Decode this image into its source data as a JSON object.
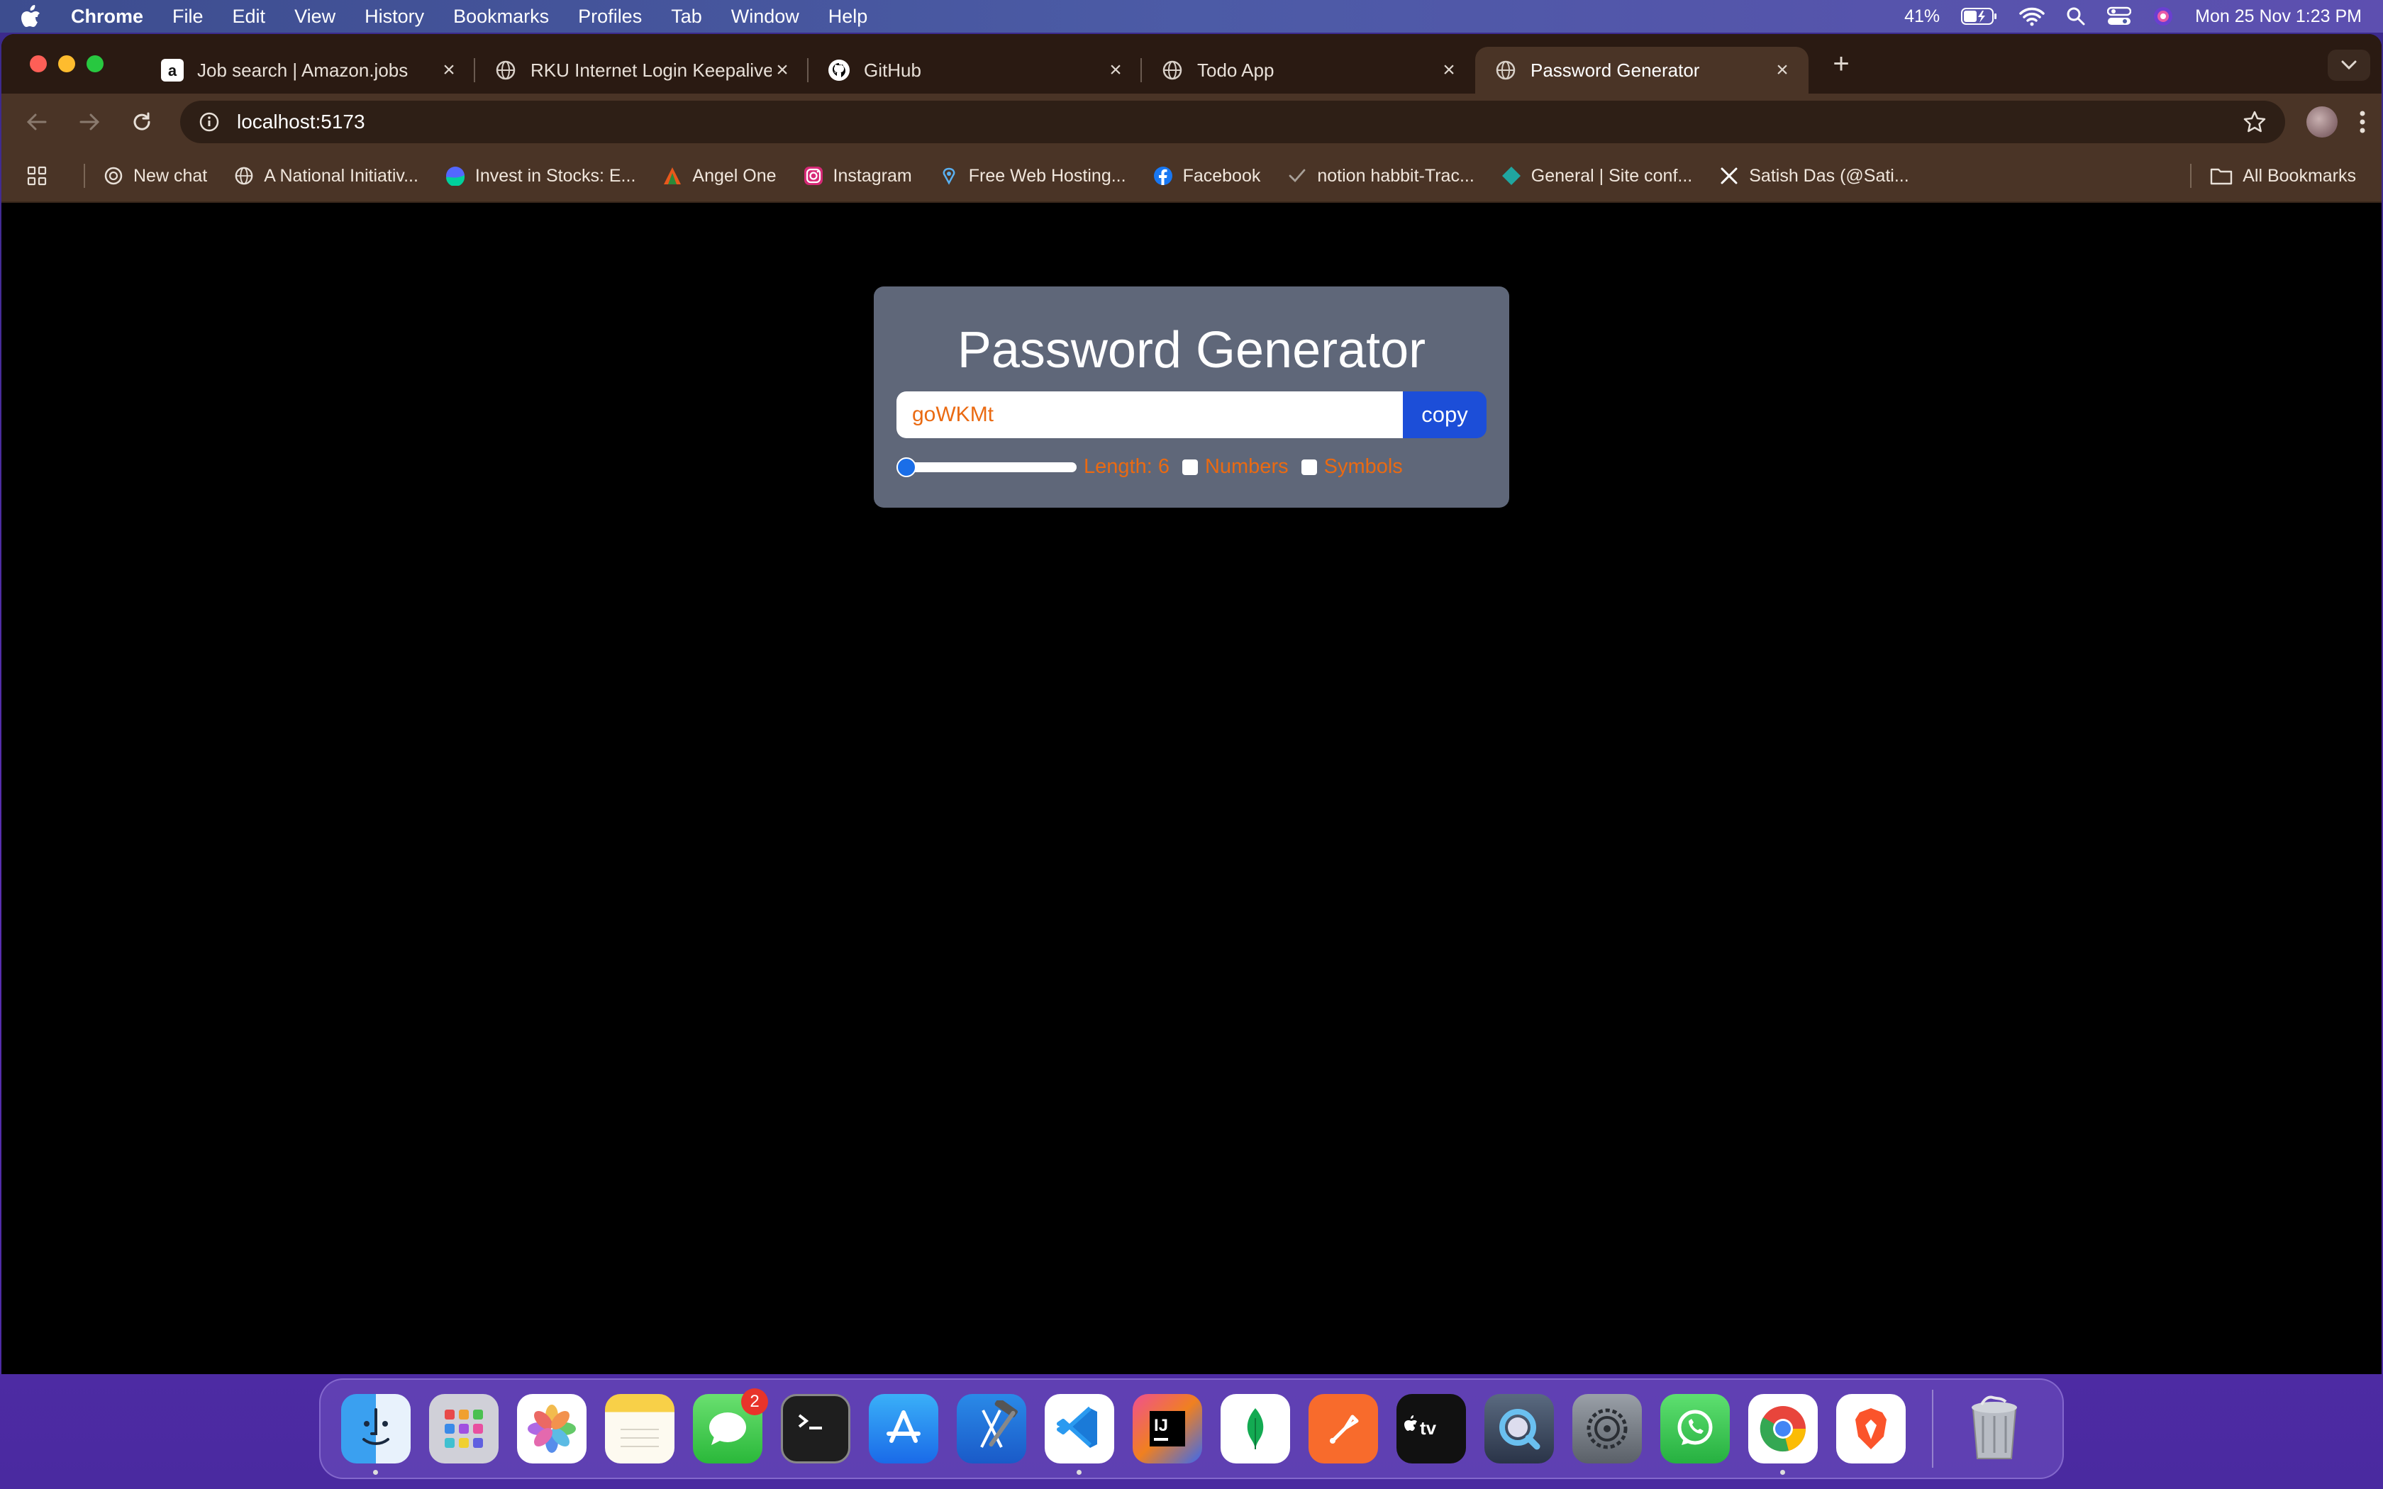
{
  "menubar": {
    "app_name": "Chrome",
    "items": [
      "File",
      "Edit",
      "View",
      "History",
      "Bookmarks",
      "Profiles",
      "Tab",
      "Window",
      "Help"
    ],
    "battery": "41%",
    "datetime": "Mon 25 Nov  1:23 PM"
  },
  "tabs": [
    {
      "title": "Job search | Amazon.jobs",
      "icon": "amazon-icon"
    },
    {
      "title": "RKU Internet Login Keepalive",
      "icon": "globe-icon"
    },
    {
      "title": "GitHub",
      "icon": "github-icon"
    },
    {
      "title": "Todo App",
      "icon": "globe-icon"
    },
    {
      "title": "Password Generator",
      "icon": "globe-icon",
      "active": true
    }
  ],
  "address": {
    "url": "localhost:5173"
  },
  "bookmarks": [
    {
      "label": "New chat",
      "icon": "openai-icon"
    },
    {
      "label": "A National Initiativ...",
      "icon": "globe-icon"
    },
    {
      "label": "Invest in Stocks: E...",
      "icon": "groww-icon"
    },
    {
      "label": "Angel One",
      "icon": "angelone-icon"
    },
    {
      "label": "Instagram",
      "icon": "instagram-icon"
    },
    {
      "label": "Free Web Hosting...",
      "icon": "hosting-icon"
    },
    {
      "label": "Facebook",
      "icon": "facebook-icon"
    },
    {
      "label": "notion habbit-Trac...",
      "icon": "check-icon"
    },
    {
      "label": "General | Site conf...",
      "icon": "netlify-icon"
    },
    {
      "label": "Satish Das (@Sati...",
      "icon": "x-icon"
    }
  ],
  "all_bookmarks": "All Bookmarks",
  "generator": {
    "title": "Password Generator",
    "password": "goWKMt",
    "copy_label": "copy",
    "length_label": "Length: 6",
    "length_value": 6,
    "length_min": 6,
    "length_max": 100,
    "numbers_label": "Numbers",
    "numbers_checked": false,
    "symbols_label": "Symbols",
    "symbols_checked": false
  },
  "dock": {
    "apps": [
      "Finder",
      "Launchpad",
      "Photos",
      "Notes",
      "Messages",
      "Terminal",
      "App Store",
      "Xcode",
      "VS Code",
      "IntelliJ IDEA",
      "MongoDB Compass",
      "Postman",
      "Apple TV",
      "QuickTime",
      "System Settings",
      "WhatsApp",
      "Chrome",
      "Brave",
      "Trash"
    ],
    "messages_badge": "2"
  },
  "colors": {
    "accent_orange": "#ea6a12",
    "button_blue": "#1c4ed8",
    "card_bg": "#5f6779"
  }
}
